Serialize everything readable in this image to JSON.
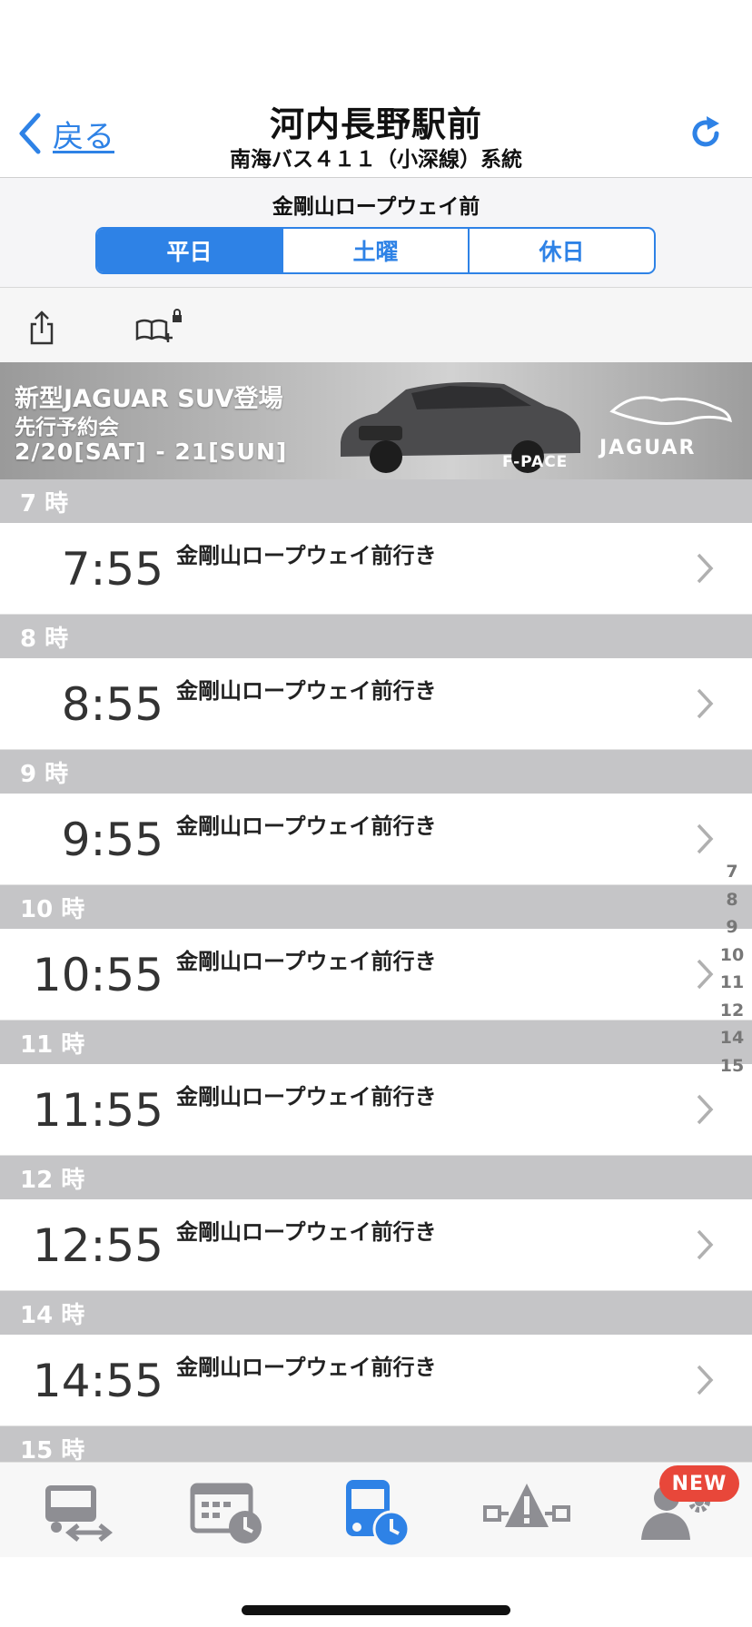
{
  "nav": {
    "back_label": "戻る",
    "title": "河内長野駅前",
    "subtitle": "南海バス４１１（小深線）系統"
  },
  "destination_header": "金剛山ロープウェイ前",
  "segments": [
    {
      "label": "平日",
      "active": true
    },
    {
      "label": "土曜",
      "active": false
    },
    {
      "label": "休日",
      "active": false
    }
  ],
  "ad": {
    "line1": "新型JAGUAR SUV登場",
    "line2": "先行予約会",
    "line3": "2/20[SAT] - 21[SUN]",
    "model": "F-PACE",
    "brand": "JAGUAR"
  },
  "timetable": [
    {
      "hour_label": "7 時",
      "time": "7:55",
      "dest": "金剛山ロープウェイ前行き"
    },
    {
      "hour_label": "8 時",
      "time": "8:55",
      "dest": "金剛山ロープウェイ前行き"
    },
    {
      "hour_label": "9 時",
      "time": "9:55",
      "dest": "金剛山ロープウェイ前行き"
    },
    {
      "hour_label": "10 時",
      "time": "10:55",
      "dest": "金剛山ロープウェイ前行き"
    },
    {
      "hour_label": "11 時",
      "time": "11:55",
      "dest": "金剛山ロープウェイ前行き"
    },
    {
      "hour_label": "12 時",
      "time": "12:55",
      "dest": "金剛山ロープウェイ前行き"
    },
    {
      "hour_label": "14 時",
      "time": "14:55",
      "dest": "金剛山ロープウェイ前行き"
    }
  ],
  "partial_hour_label": "15 時",
  "hour_index": [
    "7",
    "8",
    "9",
    "10",
    "11",
    "12",
    "14",
    "15"
  ],
  "tab_bar": {
    "badge": "NEW",
    "tabs": [
      {
        "icon": "bus-transfer-icon",
        "active": false
      },
      {
        "icon": "timetable-clock-icon",
        "active": false
      },
      {
        "icon": "bus-clock-icon",
        "active": true
      },
      {
        "icon": "traffic-warning-icon",
        "active": false
      },
      {
        "icon": "user-settings-icon",
        "active": false
      }
    ]
  },
  "colors": {
    "accent": "#2e82e6",
    "header_gray": "#c5c5c7",
    "badge_red": "#e8473a"
  }
}
